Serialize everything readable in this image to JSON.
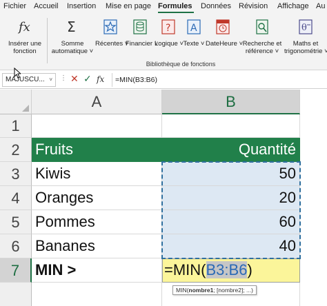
{
  "menu": {
    "tabs": [
      "Fichier",
      "Accueil",
      "Insertion",
      "Mise en page",
      "Formules",
      "Données",
      "Révision",
      "Affichage",
      "Au"
    ],
    "active": "Formules"
  },
  "ribbon": {
    "insert_function": {
      "line1": "Insérer une",
      "line2": "fonction",
      "icon": "fx-icon"
    },
    "autosum": {
      "line1": "Somme",
      "line2": "automatique",
      "icon": "sigma-icon"
    },
    "recent": {
      "label": "Récentes",
      "icon": "star-icon"
    },
    "financial": {
      "label": "Financier",
      "icon": "database-icon"
    },
    "logical": {
      "label": "Logique",
      "icon": "question-icon"
    },
    "text": {
      "label": "Texte",
      "icon": "text-a-icon"
    },
    "datetime": {
      "label": "DateHeure",
      "icon": "calendar-clock-icon"
    },
    "lookup": {
      "line1": "Recherche et",
      "line2": "référence",
      "icon": "lookup-icon"
    },
    "math": {
      "line1": "Maths et",
      "line2": "trigonométrie",
      "icon": "math-icon"
    },
    "group_label": "Bibliothèque de fonctions"
  },
  "formula_bar": {
    "name_box": "MAJUSCU...",
    "cancel_symbol": "✕",
    "enter_symbol": "✓",
    "fx_symbol": "fx",
    "formula": "=MIN(B3:B6)"
  },
  "sheet": {
    "columns": [
      "A",
      "B"
    ],
    "rows": [
      "1",
      "2",
      "3",
      "4",
      "5",
      "6",
      "7"
    ],
    "header_row": {
      "a": "Fruits",
      "b": "Quantité"
    },
    "data": [
      {
        "a": "Kiwis",
        "b": "50"
      },
      {
        "a": "Oranges",
        "b": "20"
      },
      {
        "a": "Pommes",
        "b": "60"
      },
      {
        "a": "Bananes",
        "b": "40"
      }
    ],
    "summary_label": "MIN >",
    "edit_prefix": "=MIN(",
    "edit_ref": "B3:B6",
    "edit_suffix": ")",
    "tooltip": {
      "fn": "MIN(",
      "arg1": "nombre1",
      "rest": "; [nombre2]; ...)"
    }
  },
  "colors": {
    "accent_green": "#1e7145",
    "header_fill": "#21804a",
    "range_fill": "#dde8f3",
    "edit_fill": "#fbf59a",
    "ref_blue": "#2b6ab5"
  }
}
